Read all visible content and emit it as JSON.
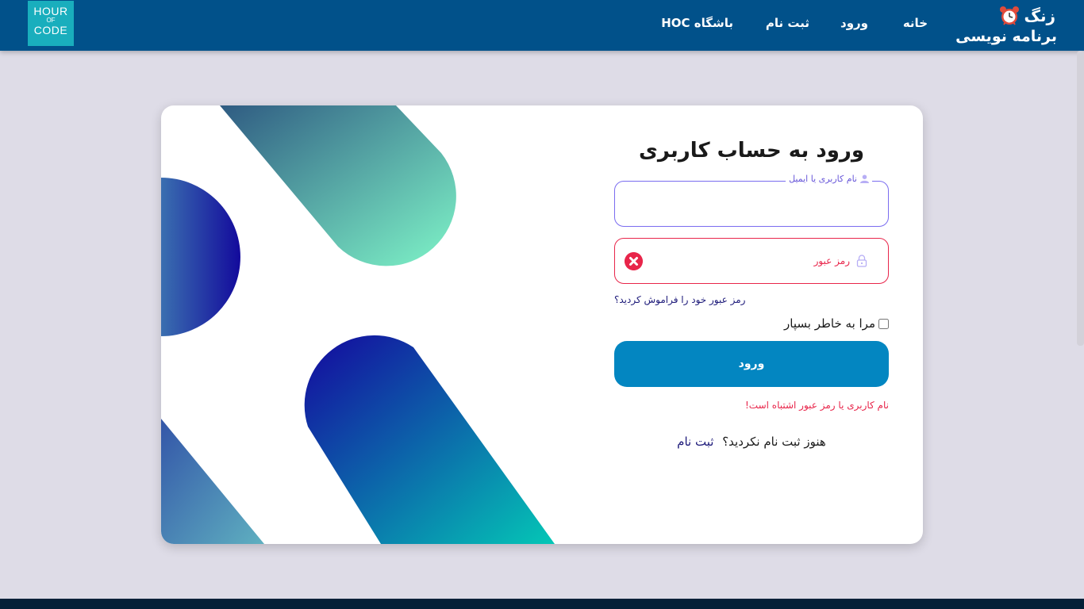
{
  "header": {
    "logo": {
      "line1": "HOUR",
      "line2": "OF",
      "line3": "CODE"
    },
    "brand": {
      "line1": "زنگ",
      "line2": "برنامه نویسی",
      "icon": "alarm-clock-icon"
    },
    "nav": {
      "home": "خانه",
      "login": "ورود",
      "register": "ثبت نام",
      "club": "باشگاه HOC"
    },
    "bg_color": "#01518a"
  },
  "login": {
    "title": "ورود به حساب کاربری",
    "username_label": "نام کاربری یا ایمیل",
    "username_value": "",
    "password_placeholder": "رمز عبور",
    "forgot_link": "رمز عبور خود را فراموش کردید؟",
    "remember_label": "مرا به خاطر بسپار",
    "remember_checked": false,
    "submit_label": "ورود",
    "error_message": "نام کاربری یا رمز عبور اشتباه است!",
    "signup_prompt": "هنوز ثبت نام نکردید؟",
    "signup_link": "ثبت نام"
  },
  "colors": {
    "primary_button": "#0386c1",
    "error": "#e8254a",
    "focus": "#7a6cf0",
    "link": "#1d1a7a"
  }
}
